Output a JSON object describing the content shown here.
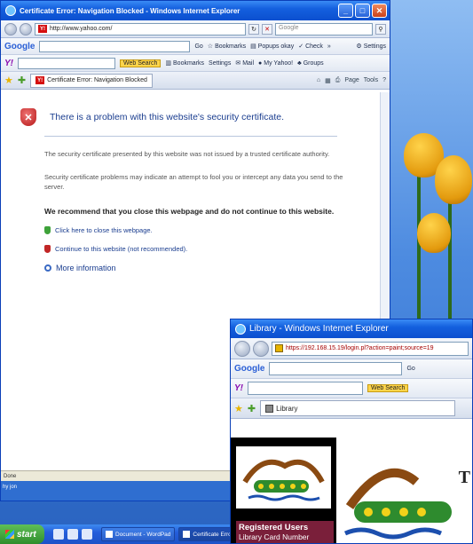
{
  "window1": {
    "title": "Certificate Error: Navigation Blocked - Windows Internet Explorer",
    "address": "http://www.yahoo.com/",
    "search_placeholder": "Google",
    "google_bar": {
      "logo": "Google",
      "go_label": "Go",
      "bookmarks": "Bookmarks",
      "popups": "Popups okay",
      "check": "Check",
      "settings": "Settings"
    },
    "yahoo_bar": {
      "web_search": "Web Search",
      "bookmarks": "Bookmarks",
      "settings": "Settings",
      "mail": "Mail",
      "my_yahoo": "My Yahoo!",
      "groups": "Groups"
    },
    "tab_label": "Certificate Error: Navigation Blocked",
    "cmd": {
      "page": "Page",
      "tools": "Tools"
    },
    "error": {
      "title": "There is a problem with this website's security certificate.",
      "para1": "The security certificate presented by this website was not issued by a trusted certificate authority.",
      "para2": "Security certificate problems may indicate an attempt to fool you or intercept any data you send to the server.",
      "recommend": "We recommend that you close this webpage and do not continue to this website.",
      "close_link": "Click here to close this webpage.",
      "continue_link": "Continue to this website (not recommended).",
      "more_info": "More information"
    },
    "status": "Done",
    "taskbar_note": "hy jon"
  },
  "window2": {
    "title": "Library - Windows Internet Explorer",
    "address": "https://192.168.15.19/login.pl?action=paint;source=19",
    "google_logo": "Google",
    "go_label": "Go",
    "web_search": "Web Search",
    "tab_label": "Library",
    "registered": "Registered Users",
    "library_card": "Library Card Number",
    "logo_trailing": "T"
  },
  "taskbar": {
    "start": "start",
    "tasks": [
      "Document - WordPad",
      "Certificate Error"
    ]
  }
}
